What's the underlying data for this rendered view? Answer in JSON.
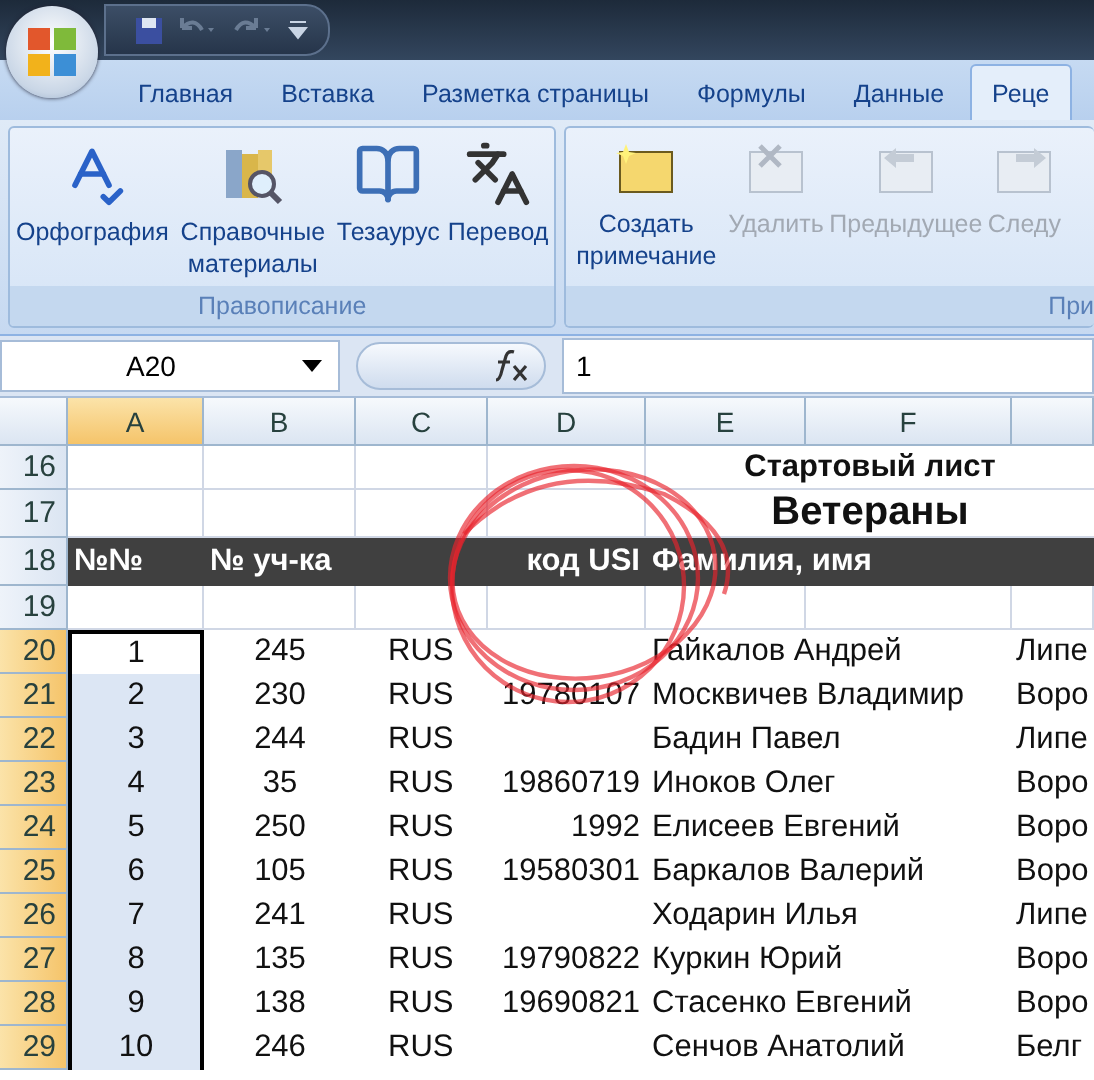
{
  "tabs": [
    {
      "label": "Главная",
      "selected": false
    },
    {
      "label": "Вставка",
      "selected": false
    },
    {
      "label": "Разметка страницы",
      "selected": false
    },
    {
      "label": "Формулы",
      "selected": false
    },
    {
      "label": "Данные",
      "selected": false
    },
    {
      "label": "Реце",
      "selected": true
    }
  ],
  "ribbon": {
    "groups": [
      {
        "label": "Правописание",
        "buttons": [
          {
            "label": "Орфография",
            "disabled": false
          },
          {
            "label": "Справочные материалы",
            "disabled": false
          },
          {
            "label": "Тезаурус",
            "disabled": false
          },
          {
            "label": "Перевод",
            "disabled": false
          }
        ]
      },
      {
        "label": "При",
        "buttons": [
          {
            "label": "Создать примечание",
            "disabled": false
          },
          {
            "label": "Удалить",
            "disabled": true
          },
          {
            "label": "Предыдущее",
            "disabled": true
          },
          {
            "label": "Следу",
            "disabled": true
          }
        ]
      }
    ]
  },
  "formula_bar": {
    "name_box": "A20",
    "value": "1"
  },
  "columns": [
    {
      "label": "A",
      "selected": true
    },
    {
      "label": "B",
      "selected": false
    },
    {
      "label": "C",
      "selected": false
    },
    {
      "label": "D",
      "selected": false
    },
    {
      "label": "E",
      "selected": false
    },
    {
      "label": "F",
      "selected": false
    }
  ],
  "rows": [
    {
      "number": "16",
      "kind": "title",
      "selected": false,
      "text": "Стартовый лист"
    },
    {
      "number": "17",
      "kind": "subtitle",
      "selected": false,
      "text": "Ветераны"
    },
    {
      "number": "18",
      "kind": "header",
      "selected": false,
      "cells": {
        "A": "№№",
        "B": "№ уч-ка",
        "D": "код USI",
        "E": "Фамилия, имя"
      }
    },
    {
      "number": "19",
      "kind": "blank",
      "selected": false
    },
    {
      "number": "20",
      "kind": "data",
      "selected": true,
      "active": true,
      "cells": {
        "A": "1",
        "B": "245",
        "C": "RUS",
        "E": "Гайкалов Андрей",
        "G": "Липе"
      }
    },
    {
      "number": "21",
      "kind": "data",
      "selected": true,
      "active": false,
      "cells": {
        "A": "2",
        "B": "230",
        "C": "RUS",
        "D": "19780107",
        "E": "Москвичев Владимир",
        "G": "Воро"
      }
    },
    {
      "number": "22",
      "kind": "data",
      "selected": true,
      "active": false,
      "cells": {
        "A": "3",
        "B": "244",
        "C": "RUS",
        "E": "Бадин Павел",
        "G": "Липе"
      }
    },
    {
      "number": "23",
      "kind": "data",
      "selected": true,
      "active": false,
      "cells": {
        "A": "4",
        "B": "35",
        "C": "RUS",
        "D": "19860719",
        "E": "Иноков Олег",
        "G": "Воро"
      }
    },
    {
      "number": "24",
      "kind": "data",
      "selected": true,
      "active": false,
      "cells": {
        "A": "5",
        "B": "250",
        "C": "RUS",
        "D": "1992",
        "E": "Елисеев Евгений",
        "G": "Воро"
      }
    },
    {
      "number": "25",
      "kind": "data",
      "selected": true,
      "active": false,
      "cells": {
        "A": "6",
        "B": "105",
        "C": "RUS",
        "D": "19580301",
        "E": "Баркалов Валерий",
        "G": "Воро"
      }
    },
    {
      "number": "26",
      "kind": "data",
      "selected": true,
      "active": false,
      "cells": {
        "A": "7",
        "B": "241",
        "C": "RUS",
        "E": "Ходарин Илья",
        "G": "Липе"
      }
    },
    {
      "number": "27",
      "kind": "data",
      "selected": true,
      "active": false,
      "cells": {
        "A": "8",
        "B": "135",
        "C": "RUS",
        "D": "19790822",
        "E": "Куркин Юрий",
        "G": "Воро"
      }
    },
    {
      "number": "28",
      "kind": "data",
      "selected": true,
      "active": false,
      "cells": {
        "A": "9",
        "B": "138",
        "C": "RUS",
        "D": "19690821",
        "E": "Стасенко Евгений",
        "G": "Воро"
      }
    },
    {
      "number": "29",
      "kind": "data",
      "selected": true,
      "active": false,
      "cells": {
        "A": "10",
        "B": "246",
        "C": "RUS",
        "E": "Сенчов Анатолий",
        "G": "Белг"
      }
    }
  ]
}
